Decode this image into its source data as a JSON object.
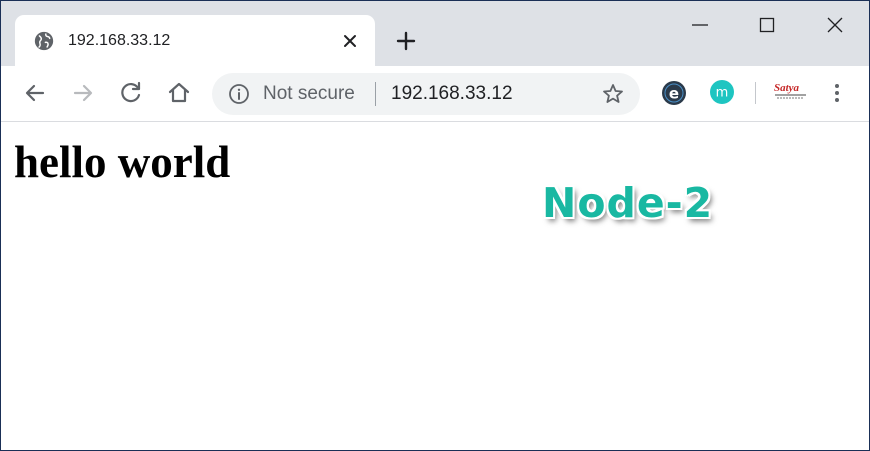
{
  "browser": {
    "tab": {
      "title": "192.168.33.12",
      "favicon_icon": "globe-icon"
    },
    "window_controls": [
      "minimize-icon",
      "maximize-icon",
      "close-icon"
    ],
    "toolbar": {
      "icons": [
        "back-arrow-icon",
        "forward-arrow-icon",
        "reload-icon",
        "home-icon"
      ],
      "omnibox": {
        "security_icon": "info-icon",
        "security_text": "Not secure",
        "url": "192.168.33.12",
        "bookmark_icon": "star-icon"
      },
      "extensions": [
        {
          "icon": "e-extension-icon",
          "letter": "e"
        },
        {
          "icon": "m-extension-icon",
          "letter": "m"
        },
        {
          "icon": "satya-extension-icon",
          "text": "Satya"
        }
      ],
      "menu_icon": "more-vert-icon"
    }
  },
  "page": {
    "heading": "hello world",
    "overlay_label": "Node-2"
  },
  "colors": {
    "tabstrip": "#dee1e6",
    "omnibox": "#f1f3f4",
    "node_label": "#19b8a2",
    "m_extension": "#1ec5c1",
    "e_extension": "#2b3a4a"
  }
}
